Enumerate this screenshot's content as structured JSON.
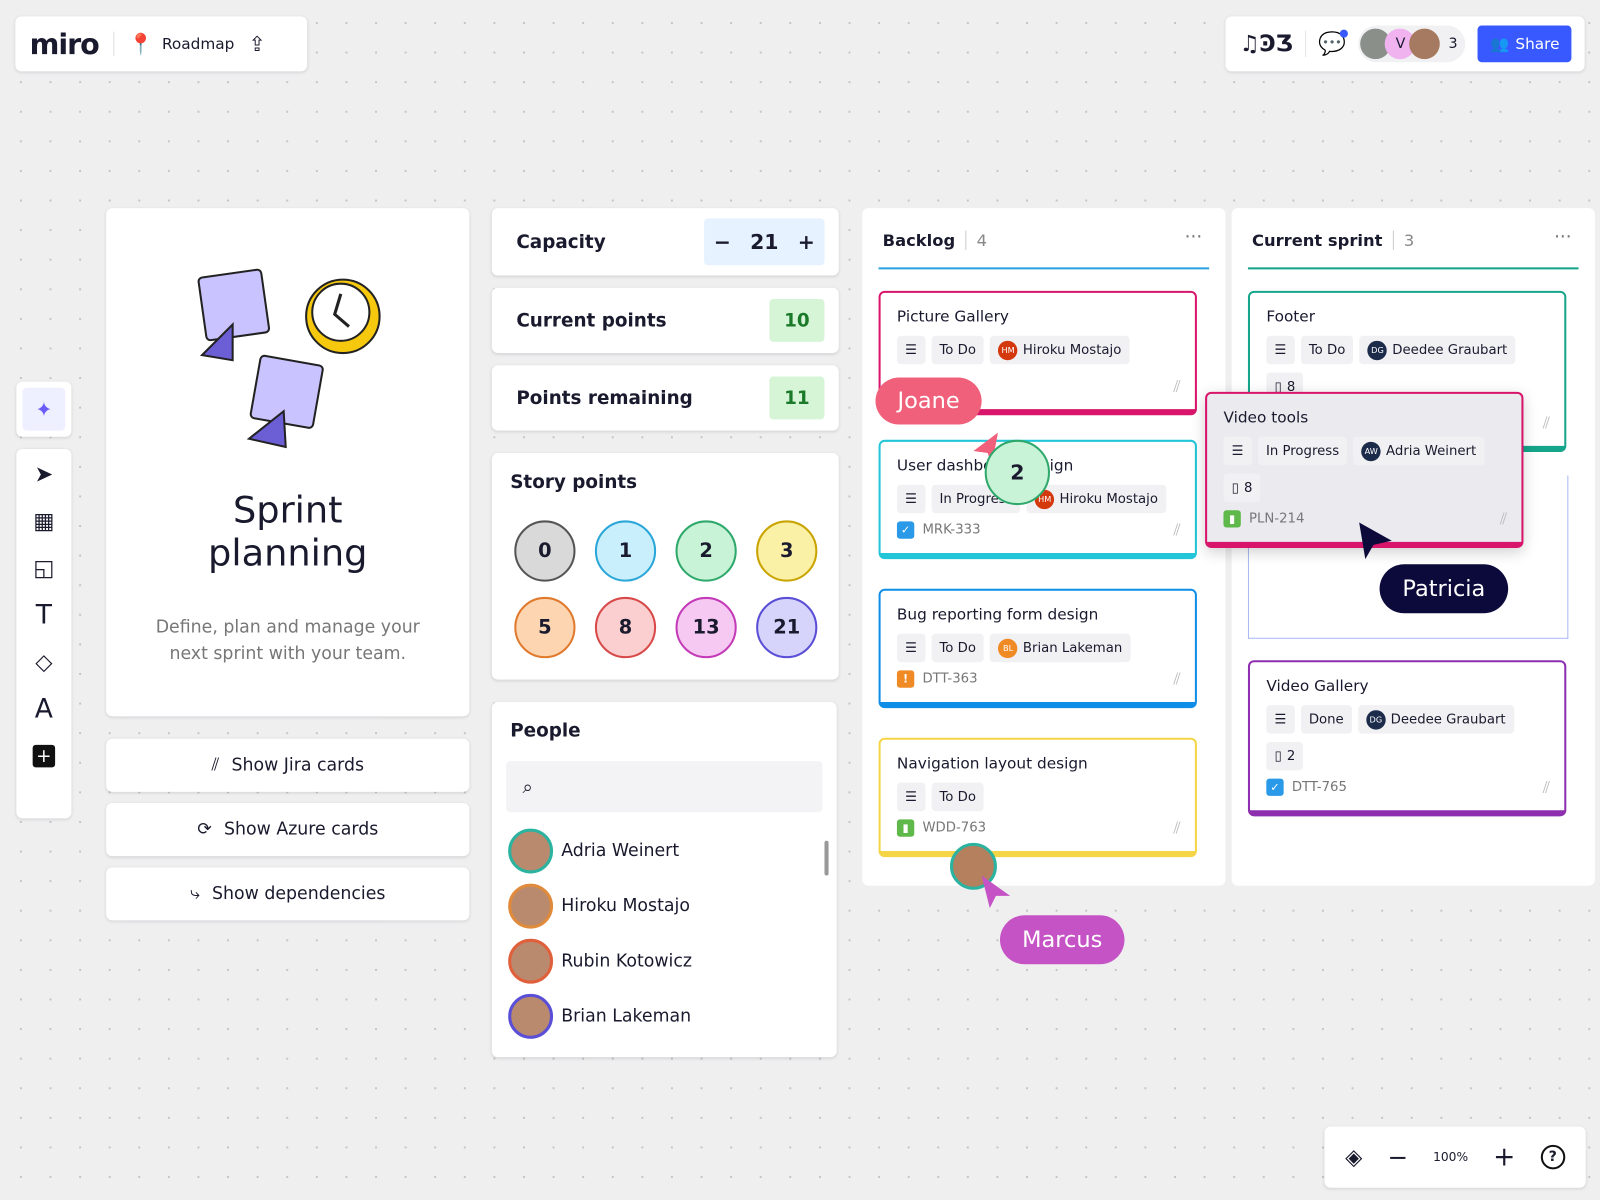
{
  "topbar": {
    "logo": "miro",
    "board_name": "Roadmap",
    "collaborator_initial": "V",
    "collaborator_count": "3",
    "share_label": "Share"
  },
  "intro": {
    "title": "Sprint planning",
    "description": "Define, plan and manage your next sprint with your team."
  },
  "actions": {
    "jira": "Show Jira cards",
    "azure": "Show Azure cards",
    "dependencies": "Show dependencies"
  },
  "capacity": {
    "label": "Capacity",
    "value": "21",
    "minus": "−",
    "plus": "+"
  },
  "current_points": {
    "label": "Current points",
    "value": "10"
  },
  "points_remaining": {
    "label": "Points remaining",
    "value": "11"
  },
  "story_points": {
    "title": "Story points",
    "values": [
      {
        "v": "0",
        "bg": "#d9d9d9",
        "bd": "#555555"
      },
      {
        "v": "1",
        "bg": "#c9eefc",
        "bd": "#2aa7d8"
      },
      {
        "v": "2",
        "bg": "#c9f3d6",
        "bd": "#2ea86b"
      },
      {
        "v": "3",
        "bg": "#fbf1a6",
        "bd": "#c9a400"
      },
      {
        "v": "5",
        "bg": "#fdd5b0",
        "bd": "#e07a2e"
      },
      {
        "v": "8",
        "bg": "#fbcfcf",
        "bd": "#d84a4a"
      },
      {
        "v": "13",
        "bg": "#f6c9f2",
        "bd": "#c43bb8"
      },
      {
        "v": "21",
        "bg": "#d6d4fb",
        "bd": "#5a4fd6"
      }
    ]
  },
  "people": {
    "title": "People",
    "search_placeholder": "",
    "list": [
      {
        "name": "Adria Weinert",
        "ring": "#2bb3a0"
      },
      {
        "name": "Hiroku Mostajo",
        "ring": "#e08a3c"
      },
      {
        "name": "Rubin Kotowicz",
        "ring": "#e0603c"
      },
      {
        "name": "Brian Lakeman",
        "ring": "#5a4fd6"
      }
    ]
  },
  "backlog": {
    "title": "Backlog",
    "count": "4",
    "cards": [
      {
        "title": "Picture Gallery",
        "status": "To Do",
        "assignee": "Hiroku Mostajo",
        "initials": "HM",
        "avatar_color": "#d4380d",
        "points": "",
        "key": "",
        "type": "",
        "border": "#d8156b"
      },
      {
        "title": "User dashboard design",
        "status": "In Progress",
        "assignee": "Hiroku Mostajo",
        "initials": "HM",
        "avatar_color": "#d4380d",
        "points": "",
        "key": "MRK-333",
        "type": "task",
        "border": "#22c6d8"
      },
      {
        "title": "Bug reporting form design",
        "status": "To Do",
        "assignee": "Brian Lakeman",
        "initials": "BL",
        "avatar_color": "#f08a24",
        "points": "",
        "key": "DTT-363",
        "type": "bug",
        "border": "#0f8ee8"
      },
      {
        "title": "Navigation layout design",
        "status": "To Do",
        "assignee": "",
        "initials": "",
        "avatar_color": "",
        "points": "",
        "key": "WDD-763",
        "type": "story",
        "border": "#f5d445"
      }
    ]
  },
  "sprint": {
    "title": "Current sprint",
    "count": "3",
    "cards": [
      {
        "title": "Footer",
        "status": "To Do",
        "assignee": "Deedee Graubart",
        "initials": "DG",
        "avatar_color": "#1c2b4a",
        "points": "8",
        "key": "",
        "type": "",
        "border": "#15a58a"
      },
      {
        "title": "Video tools",
        "status": "In Progress",
        "assignee": "Adria Weinert",
        "initials": "AW",
        "avatar_color": "#1c2b4a",
        "points": "8",
        "key": "PLN-214",
        "type": "story",
        "border": "#d8156b"
      },
      {
        "title": "Video Gallery",
        "status": "Done",
        "assignee": "Deedee Graubart",
        "initials": "DG",
        "avatar_color": "#1c2b4a",
        "points": "2",
        "key": "DTT-765",
        "type": "task",
        "border": "#8e2fb0"
      }
    ]
  },
  "cursors": {
    "joane": {
      "name": "Joane",
      "color": "#f0607a"
    },
    "patricia": {
      "name": "Patricia",
      "color": "#0b0a3a"
    },
    "marcus": {
      "name": "Marcus",
      "color": "#c553c5"
    }
  },
  "sticky_point": "2",
  "zoom": {
    "level": "100%"
  },
  "colors": {
    "accent": "#3859ff"
  }
}
